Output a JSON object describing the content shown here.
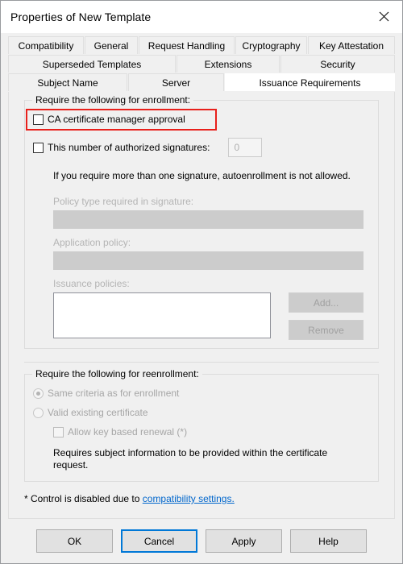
{
  "window": {
    "title": "Properties of New Template",
    "close_icon": "close-icon"
  },
  "tabs": {
    "row1": [
      {
        "label": "Compatibility",
        "active": false
      },
      {
        "label": "General",
        "active": false
      },
      {
        "label": "Request Handling",
        "active": false
      },
      {
        "label": "Cryptography",
        "active": false
      },
      {
        "label": "Key Attestation",
        "active": false
      }
    ],
    "row2": [
      {
        "label": "Superseded Templates",
        "active": false
      },
      {
        "label": "Extensions",
        "active": false
      },
      {
        "label": "Security",
        "active": false
      }
    ],
    "row3": [
      {
        "label": "Subject Name",
        "active": false
      },
      {
        "label": "Server",
        "active": false
      },
      {
        "label": "Issuance Requirements",
        "active": true
      }
    ]
  },
  "enrollment_group": {
    "legend": "Require the following for enrollment:",
    "ca_approval": {
      "label": "CA certificate manager approval",
      "checked": false,
      "highlighted": true,
      "highlight_color": "#e8201b"
    },
    "auth_signatures": {
      "label": "This number of authorized signatures:",
      "checked": false,
      "value": "0"
    },
    "hint": "If you require more than one signature, autoenrollment is not allowed.",
    "policy_type": {
      "label": "Policy type required in signature:",
      "value": "",
      "disabled": true
    },
    "application_policy": {
      "label": "Application policy:",
      "value": "",
      "disabled": true
    },
    "issuance_policies": {
      "label": "Issuance policies:",
      "items": [],
      "disabled": true
    },
    "add_button": "Add...",
    "remove_button": "Remove"
  },
  "reenrollment_group": {
    "legend": "Require the following for reenrollment:",
    "same_criteria": {
      "label": "Same criteria as for enrollment",
      "selected": true,
      "disabled": true
    },
    "valid_existing": {
      "label": "Valid existing certificate",
      "selected": false,
      "disabled": true
    },
    "allow_key_renewal": {
      "label": "Allow key based renewal (*)",
      "checked": false,
      "disabled": true
    },
    "note": "Requires subject information to be provided within the certificate request."
  },
  "footnote": {
    "prefix": "* Control is disabled due to ",
    "link": "compatibility settings.",
    "link_color": "#0066cc"
  },
  "buttons": {
    "ok": "OK",
    "cancel": "Cancel",
    "apply": "Apply",
    "help": "Help",
    "focused": "Cancel"
  }
}
